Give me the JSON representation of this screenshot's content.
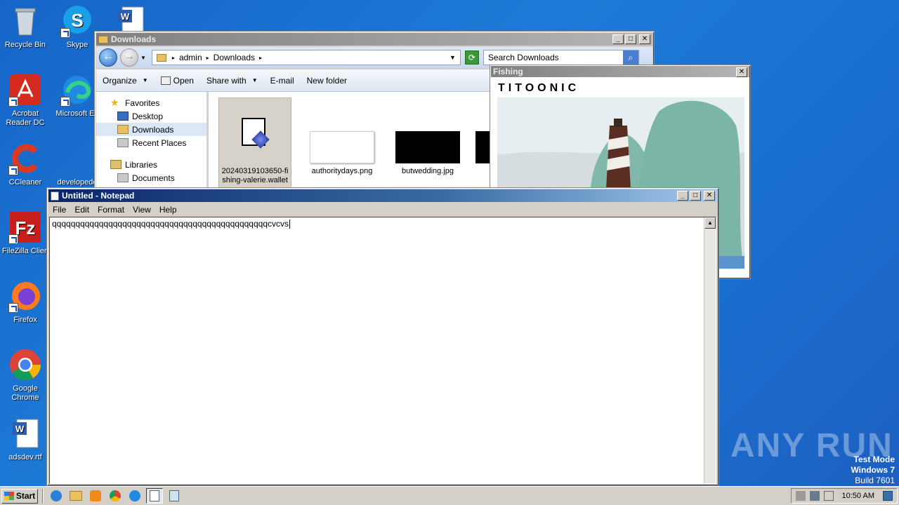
{
  "desktop": {
    "icons": [
      {
        "label": "Recycle Bin"
      },
      {
        "label": "Skype"
      },
      {
        "label": "Acrobat Reader DC"
      },
      {
        "label": "Microsoft Ed"
      },
      {
        "label": "CCleaner"
      },
      {
        "label": "developedd"
      },
      {
        "label": "FileZilla Clien"
      },
      {
        "label": "Firefox"
      },
      {
        "label": "Google Chrome"
      },
      {
        "label": "adsdev.rtf"
      }
    ]
  },
  "explorer": {
    "title": "Downloads",
    "breadcrumb": [
      "admin",
      "Downloads"
    ],
    "search_placeholder": "Search Downloads",
    "toolbar": {
      "organize": "Organize",
      "open": "Open",
      "share_with": "Share with",
      "email": "E-mail",
      "new_folder": "New folder"
    },
    "nav": {
      "favorites": "Favorites",
      "desktop": "Desktop",
      "downloads": "Downloads",
      "recent_places": "Recent Places",
      "libraries": "Libraries",
      "documents": "Documents"
    },
    "files": [
      {
        "name": "20240319103650-fishing-valerie.wallet"
      },
      {
        "name": "authoritydays.png"
      },
      {
        "name": "butwedding.jpg"
      }
    ]
  },
  "fishing": {
    "title": "Fishing",
    "brand": "TITOONIC"
  },
  "notepad": {
    "title": "Untitled - Notepad",
    "menu": {
      "file": "File",
      "edit": "Edit",
      "format": "Format",
      "view": "View",
      "help": "Help"
    },
    "content": "qqqqqqqqqqqqqqqqqqqqqqqqqqqqqqqqqqqqqqqqqqqqqqcvcvs"
  },
  "watermark": {
    "brand": "ANY RUN",
    "test_mode": "Test Mode",
    "os": "Windows 7",
    "build": "Build 7601"
  },
  "taskbar": {
    "start_label": "Start",
    "clock": "10:50 AM"
  }
}
